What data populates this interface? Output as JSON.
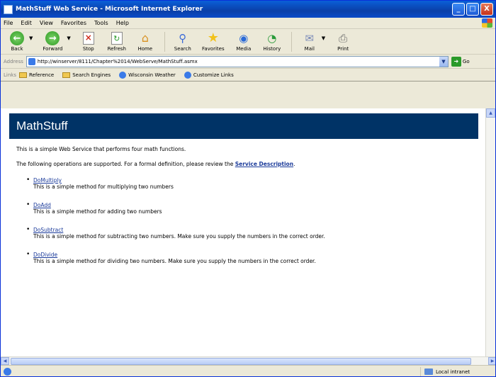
{
  "window": {
    "title": "MathStuff Web Service - Microsoft Internet Explorer",
    "controls": {
      "minimize": "_",
      "maximize": "□",
      "close": "X"
    }
  },
  "menubar": [
    "File",
    "Edit",
    "View",
    "Favorites",
    "Tools",
    "Help"
  ],
  "toolbar": {
    "back": "Back",
    "forward": "Forward",
    "stop": "Stop",
    "refresh": "Refresh",
    "home": "Home",
    "search": "Search",
    "favorites": "Favorites",
    "media": "Media",
    "history": "History",
    "mail": "Mail",
    "print": "Print"
  },
  "address": {
    "label": "Address",
    "url": "http://winserver/8111/Chapter%2014/WebServe/MathStuff.asmx",
    "go": "Go"
  },
  "links": {
    "label": "Links",
    "items": [
      "Reference",
      "Search Engines",
      "Wisconsin Weather",
      "Customize Links"
    ]
  },
  "page": {
    "heading": "MathStuff",
    "intro": "This is a simple Web Service that performs four math functions.",
    "supported_text": "The following operations are supported. For a formal definition, please review the",
    "service_description": "Service Description",
    "supported_end": ".",
    "operations": [
      {
        "name": "DoMultiply",
        "description": "This is a simple method for multiplying two numbers"
      },
      {
        "name": "DoAdd",
        "description": "This is a simple method for adding two numbers"
      },
      {
        "name": "DoSubtract",
        "description": "This is a simple method for subtracting two numbers. Make sure you supply the numbers in the correct order."
      },
      {
        "name": "DoDivide",
        "description": "This is a simple method for dividing two numbers. Make sure you supply the numbers in the correct order."
      }
    ]
  },
  "status": {
    "zone": "Local intranet"
  }
}
